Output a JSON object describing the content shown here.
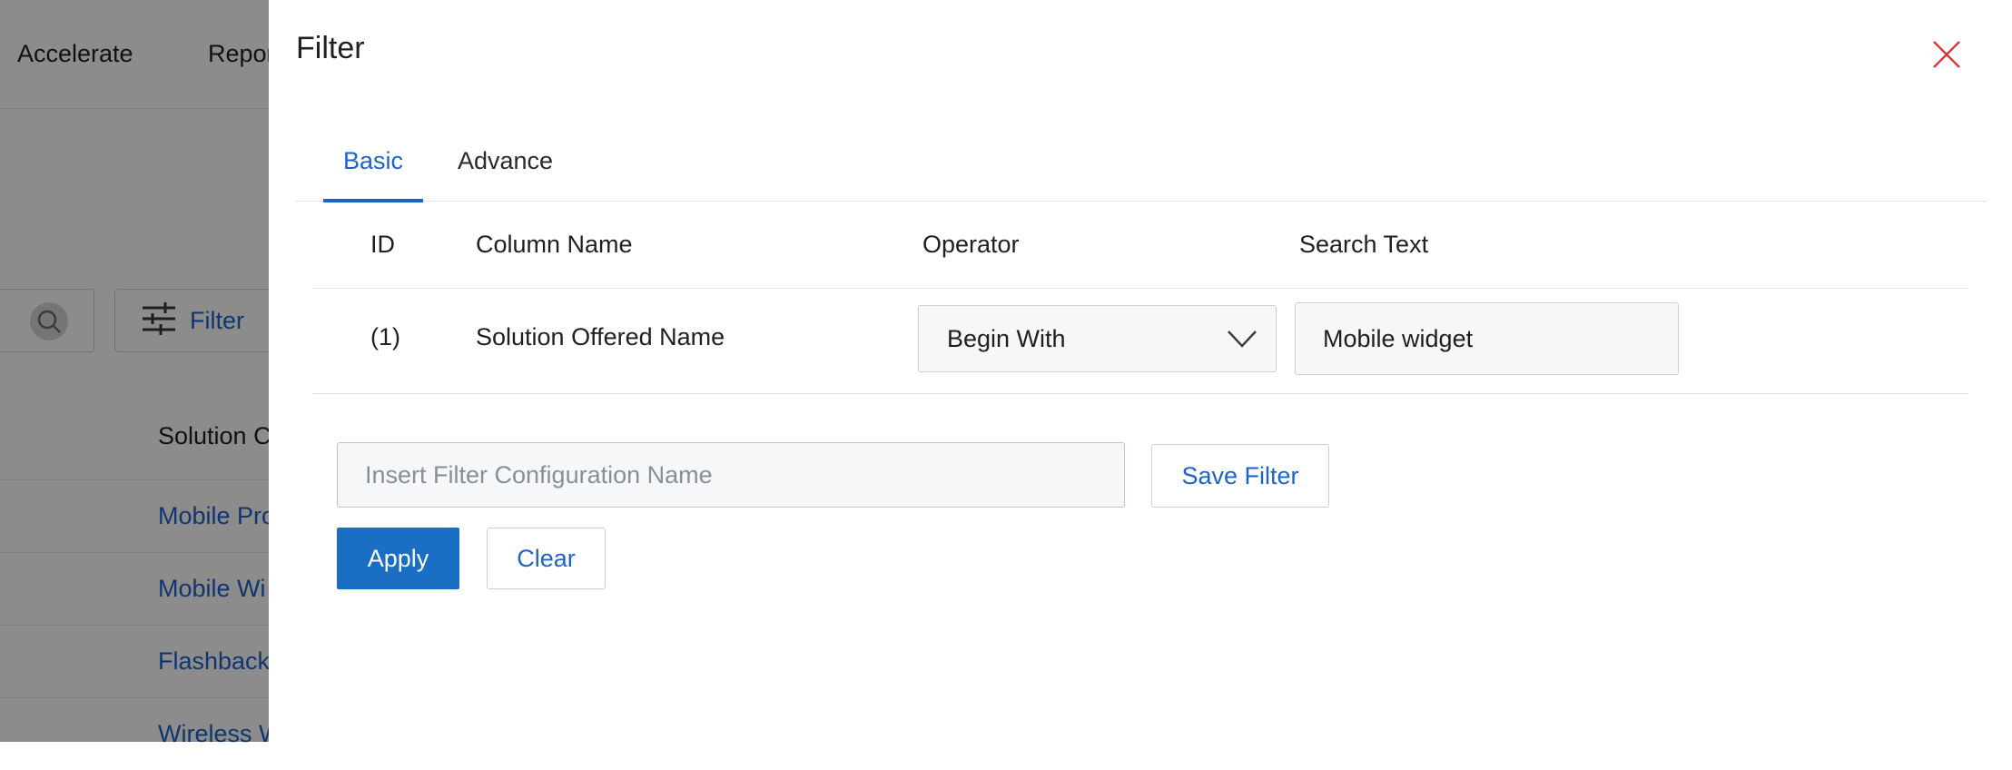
{
  "background": {
    "nav": [
      {
        "label": "Accelerate"
      },
      {
        "label": "Repor"
      }
    ],
    "filter_button_label": "Filter",
    "column_header": "Solution C",
    "rows": [
      {
        "label": "Mobile Pro"
      },
      {
        "label": "Mobile Wi"
      },
      {
        "label": "Flashback"
      },
      {
        "label": "Wireless W"
      }
    ]
  },
  "filter_panel": {
    "title": "Filter",
    "tabs": [
      {
        "label": "Basic",
        "active": true
      },
      {
        "label": "Advance",
        "active": false
      }
    ],
    "table": {
      "headers": {
        "id": "ID",
        "column_name": "Column Name",
        "operator": "Operator",
        "search_text": "Search Text"
      },
      "rows": [
        {
          "id": "(1)",
          "column_name": "Solution Offered Name",
          "operator": "Begin With",
          "search_text": "Mobile widget"
        }
      ]
    },
    "config_name": {
      "value": "",
      "placeholder": "Insert Filter Configuration Name"
    },
    "save_filter_label": "Save Filter",
    "apply_label": "Apply",
    "clear_label": "Clear"
  },
  "colors": {
    "accent": "#1e63c7",
    "apply_bg": "#1a6fc4",
    "close_icon": "#d9363e",
    "overlay": "rgba(0,0,0,0.45)"
  },
  "icons": {
    "close": "close-icon",
    "chevron": "chevron-down-icon",
    "search": "search-icon",
    "filter": "sliders-icon"
  }
}
